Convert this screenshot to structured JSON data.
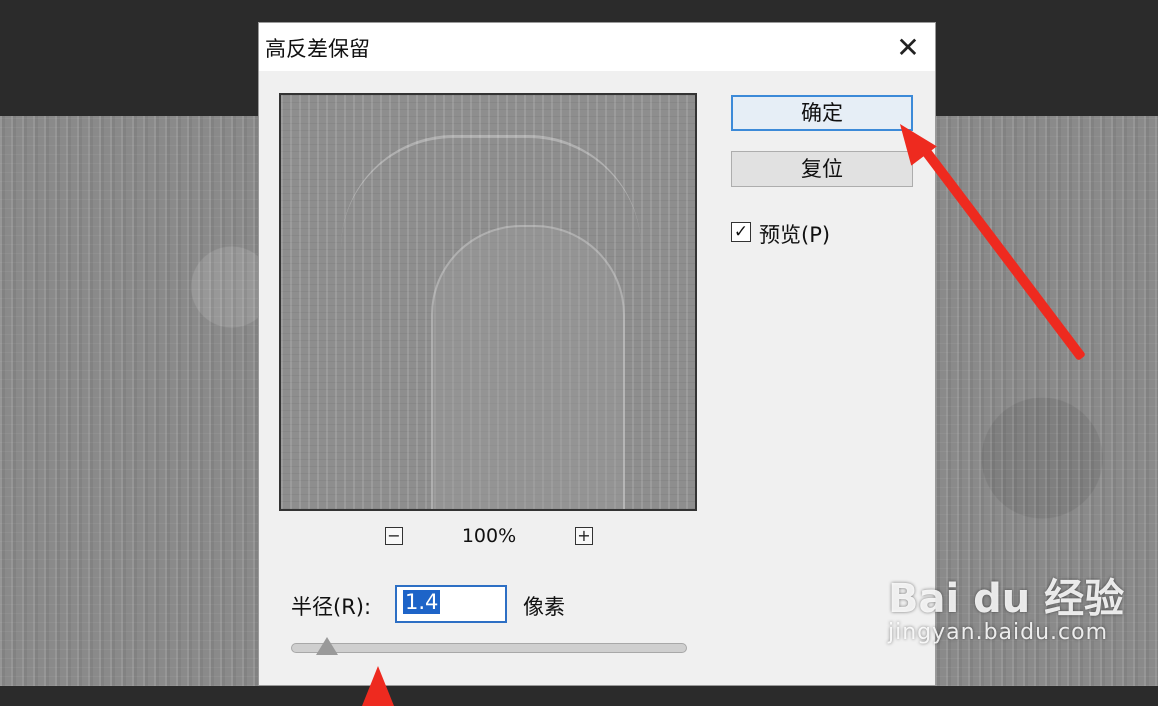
{
  "dialog": {
    "title": "高反差保留",
    "close_glyph": "✕",
    "buttons": {
      "ok_label": "确定",
      "reset_label": "复位"
    },
    "preview_checkbox": {
      "label": "预览(P)",
      "checked": true,
      "check_glyph": "✓"
    },
    "zoom": {
      "minus_glyph": "−",
      "plus_glyph": "+",
      "level": "100%"
    },
    "radius": {
      "label": "半径(R):",
      "value": "1.4",
      "unit": "像素",
      "slider_fraction": 0.05
    }
  },
  "watermark": {
    "logo_text": "Bai du 经验",
    "url": "jingyan.baidu.com"
  },
  "colors": {
    "annotation_arrow": "#ee2a1f",
    "focus_border": "#3c8ad8",
    "selection": "#1e64c8"
  },
  "icons": [
    "close-icon",
    "zoom-out-icon",
    "zoom-in-icon",
    "checkmark-icon",
    "annotation-arrow"
  ]
}
